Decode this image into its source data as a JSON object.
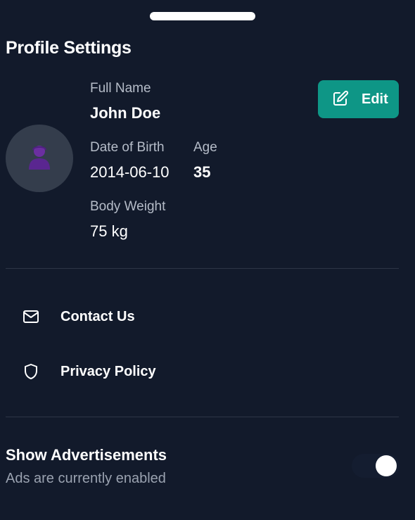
{
  "header": {
    "title": "Profile Settings"
  },
  "profile": {
    "avatar_icon": "user-icon",
    "full_name_label": "Full Name",
    "full_name": "John Doe",
    "dob_label": "Date of Birth",
    "dob": "2014-06-10",
    "age_label": "Age",
    "age": "35",
    "weight_label": "Body Weight",
    "weight": "75 kg",
    "edit_label": "Edit",
    "edit_icon": "edit-icon"
  },
  "menu": {
    "items": [
      {
        "label": "Contact Us",
        "icon": "mail-icon"
      },
      {
        "label": "Privacy Policy",
        "icon": "shield-icon"
      }
    ]
  },
  "ads": {
    "title": "Show Advertisements",
    "status": "Ads are currently enabled",
    "enabled": true
  },
  "colors": {
    "background": "#121a2b",
    "accent": "#0e9686",
    "avatar_bg": "#343d4c",
    "avatar_figure": "#6b2fa0",
    "divider": "#2e3647"
  }
}
